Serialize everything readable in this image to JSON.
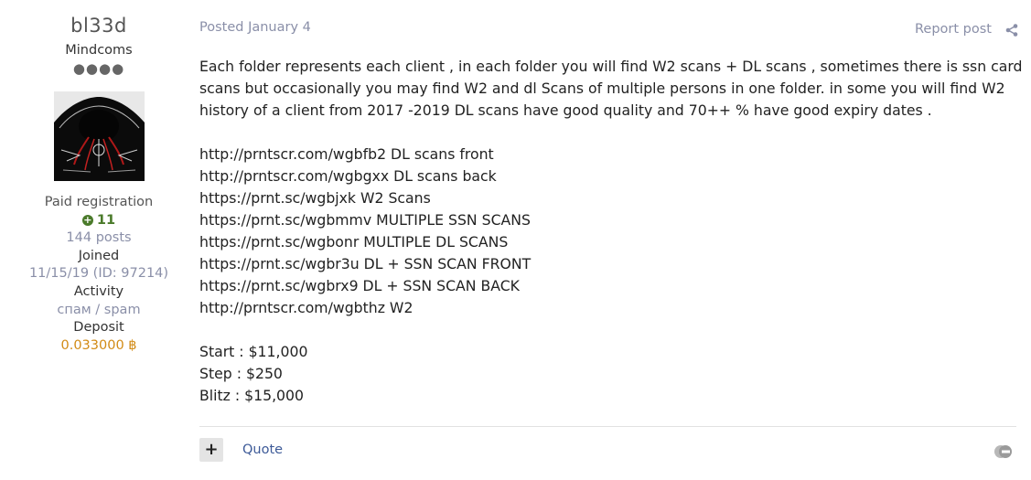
{
  "author": {
    "name": "bl33d",
    "group": "Mindcoms",
    "rank_pips": "●●●●",
    "registration": "Paid registration",
    "reputation": "11",
    "posts": "144 posts",
    "joined_label": "Joined",
    "joined_value": "11/15/19 (ID: 97214)",
    "activity_label": "Activity",
    "activity_value": "спам / spam",
    "deposit_label": "Deposit",
    "deposit_value": "0.033000 ฿"
  },
  "post": {
    "posted": "Posted January 4",
    "report": "Report post",
    "intro": "Each folder represents each client , in each folder you will find W2 scans + DL scans , sometimes there is ssn card scans but occasionally you may find W2 and dl Scans of multiple persons in one folder. in some you will find W2 history of a client from  2017 -2019  DL scans have good quality and 70++ % have good expiry dates .",
    "links": [
      "http://prntscr.com/wgbfb2  DL scans front",
      "http://prntscr.com/wgbgxx DL scans back",
      "https://prnt.sc/wgbjxk W2 Scans",
      "https://prnt.sc/wgbmmv MULTIPLE SSN SCANS",
      "https://prnt.sc/wgbonr MULTIPLE DL SCANS",
      "https://prnt.sc/wgbr3u DL + SSN SCAN FRONT",
      "https://prnt.sc/wgbrx9 DL + SSN SCAN BACK",
      "http://prntscr.com/wgbthz W2"
    ],
    "pricing": [
      "Start : $11,000",
      "Step : $250",
      "Blitz : $15,000"
    ]
  },
  "footer": {
    "plus": "+",
    "quote": "Quote"
  },
  "icons": {
    "share": "share-icon",
    "multiquote": "multiquote-icon",
    "reputation": "plus-circle-icon"
  }
}
